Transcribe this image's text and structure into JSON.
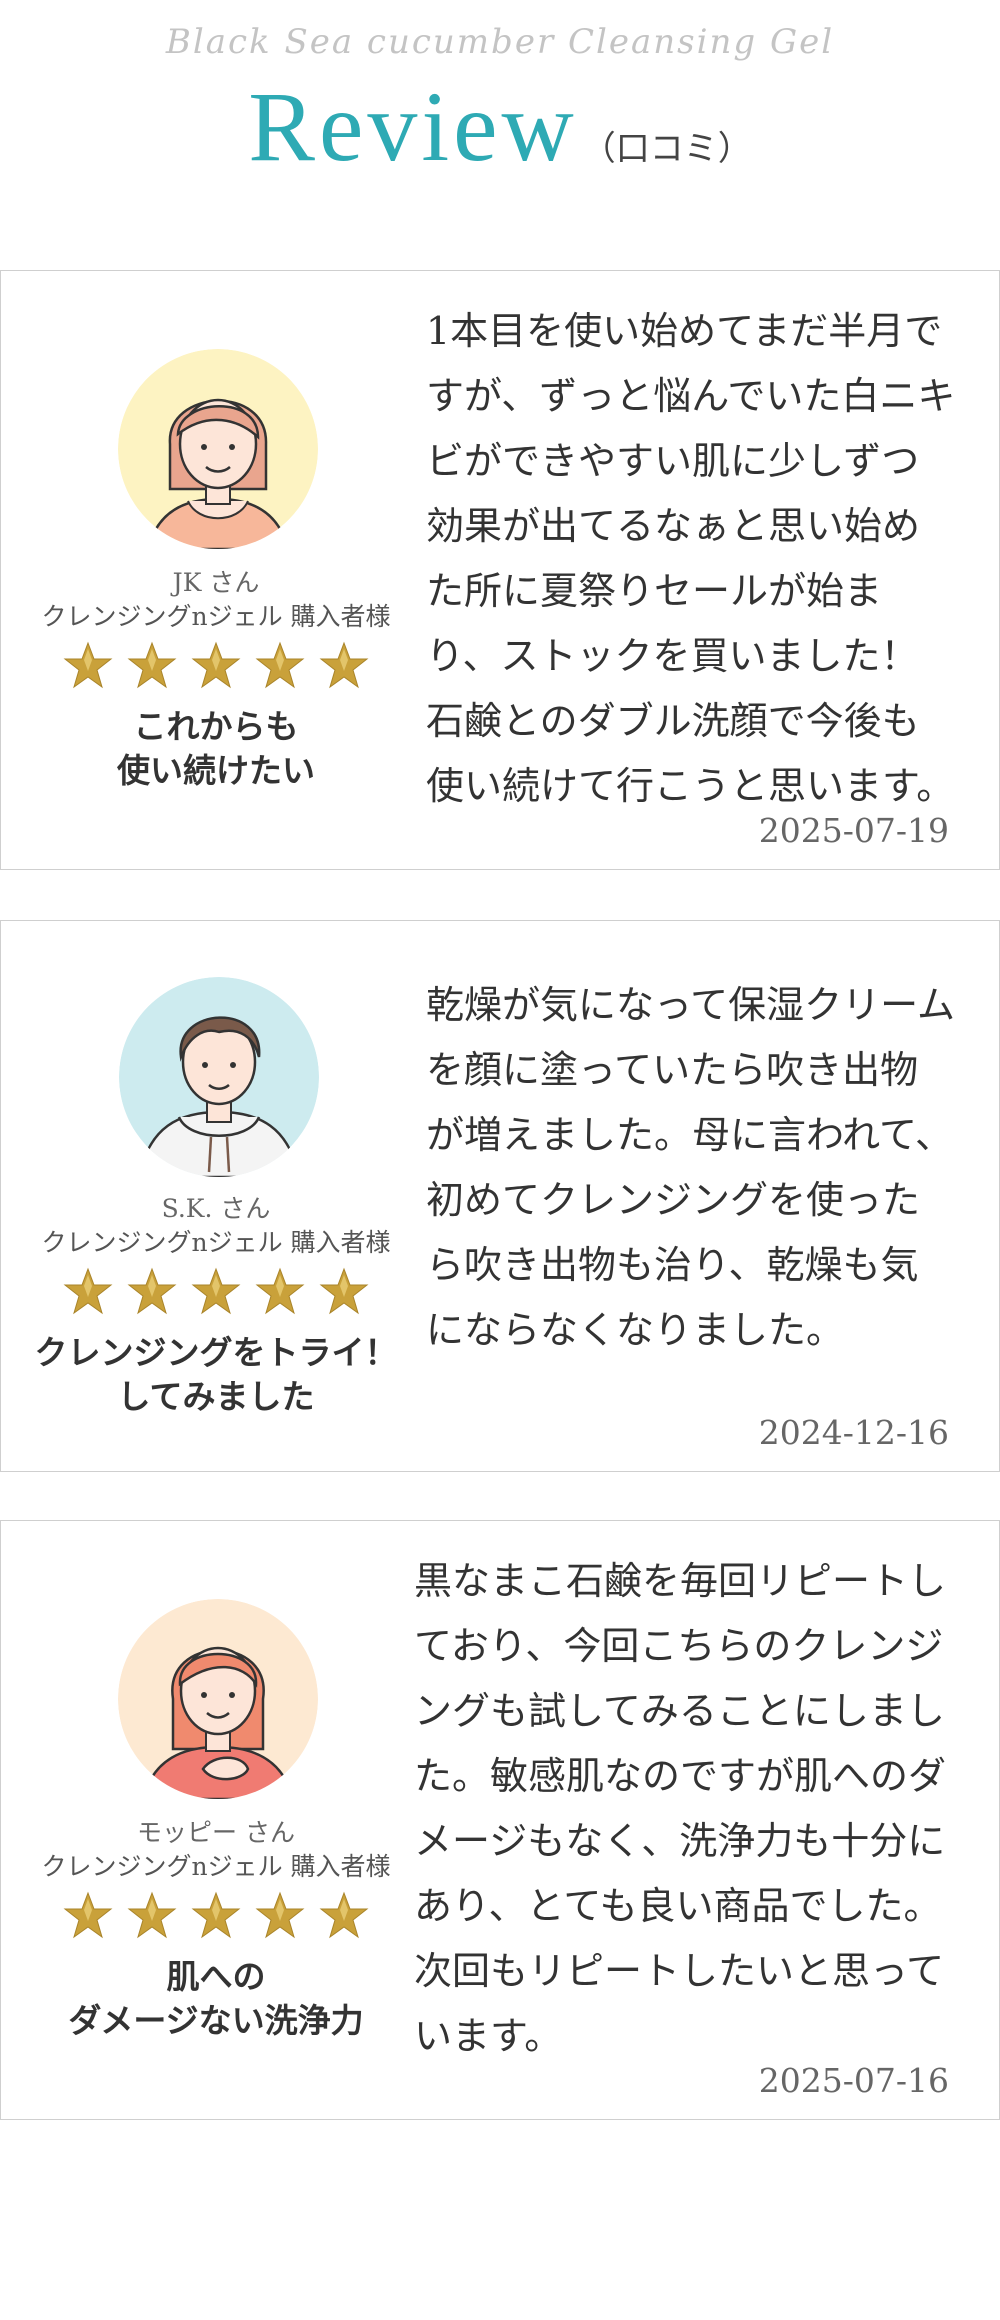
{
  "header": {
    "subtitle": "Black Sea cucumber Cleansing Gel",
    "title": "Review",
    "title_suffix": "（口コミ）"
  },
  "colors": {
    "accent": "#2eaab4",
    "star_gold": "#c9a13a",
    "border": "#cfcfcf"
  },
  "reviews": [
    {
      "avatar_icon": "woman-short-hair-avatar-icon",
      "avatar_bg": "#fdf3c2",
      "name": "JK さん",
      "role": "クレンジングnジェル 購入者様",
      "rating": 5,
      "headline_line1": "これからも",
      "headline_line2": "使い続けたい",
      "body": "1本目を使い始めてまだ半月ですが、ずっと悩んでいた白ニキビができやすい肌に少しずつ効果が出てるなぁと思い始めた所に夏祭りセールが始まり、ストックを買いました！石鹸とのダブル洗顔で今後も使い続けて行こうと思います。",
      "date": "2025-07-19"
    },
    {
      "avatar_icon": "man-hoodie-avatar-icon",
      "avatar_bg": "#cdebef",
      "name": "S.K. さん",
      "role": "クレンジングnジェル 購入者様",
      "rating": 5,
      "headline_line1": "クレンジングをトライ！",
      "headline_line2": "してみました",
      "body": "乾燥が気になって保湿クリームを顔に塗っていたら吹き出物が増えました。母に言われて、初めてクレンジングを使ったら吹き出物も治り、乾燥も気にならなくなりました。",
      "date": "2024-12-16"
    },
    {
      "avatar_icon": "woman-hand-on-chest-avatar-icon",
      "avatar_bg": "#fde9d2",
      "name": "モッピー さん",
      "role": "クレンジングnジェル 購入者様",
      "rating": 5,
      "headline_line1": "肌への",
      "headline_line2": "ダメージない洗浄力",
      "body": "黒なまこ石鹸を毎回リピートしており、今回こちらのクレンジングも試してみることにしました。敏感肌なのですが肌へのダメージもなく、洗浄力も十分にあり、とても良い商品でした。次回もリピートしたいと思っています。",
      "date": "2025-07-16"
    }
  ]
}
